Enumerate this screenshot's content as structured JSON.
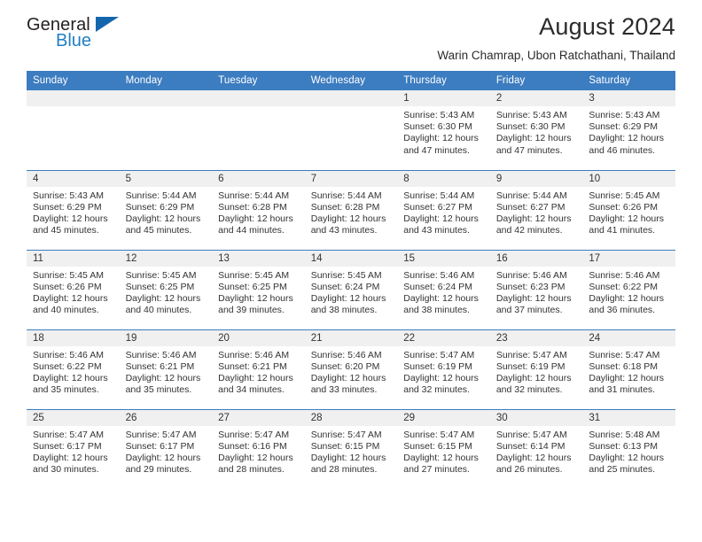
{
  "brand": {
    "line1": "General",
    "line2": "Blue",
    "triangle_color": "#1466ad",
    "blue_color": "#1f7ec4"
  },
  "header": {
    "title": "August 2024",
    "subtitle": "Warin Chamrap, Ubon Ratchathani, Thailand"
  },
  "theme": {
    "header_blue": "#3c7cc0",
    "daynum_gray": "#f0f0f0",
    "text": "#333333"
  },
  "weekdays": [
    "Sunday",
    "Monday",
    "Tuesday",
    "Wednesday",
    "Thursday",
    "Friday",
    "Saturday"
  ],
  "weeks": [
    [
      {
        "day": "",
        "sunrise": "",
        "sunset": "",
        "daylight1": "",
        "daylight2": ""
      },
      {
        "day": "",
        "sunrise": "",
        "sunset": "",
        "daylight1": "",
        "daylight2": ""
      },
      {
        "day": "",
        "sunrise": "",
        "sunset": "",
        "daylight1": "",
        "daylight2": ""
      },
      {
        "day": "",
        "sunrise": "",
        "sunset": "",
        "daylight1": "",
        "daylight2": ""
      },
      {
        "day": "1",
        "sunrise": "Sunrise: 5:43 AM",
        "sunset": "Sunset: 6:30 PM",
        "daylight1": "Daylight: 12 hours",
        "daylight2": "and 47 minutes."
      },
      {
        "day": "2",
        "sunrise": "Sunrise: 5:43 AM",
        "sunset": "Sunset: 6:30 PM",
        "daylight1": "Daylight: 12 hours",
        "daylight2": "and 47 minutes."
      },
      {
        "day": "3",
        "sunrise": "Sunrise: 5:43 AM",
        "sunset": "Sunset: 6:29 PM",
        "daylight1": "Daylight: 12 hours",
        "daylight2": "and 46 minutes."
      }
    ],
    [
      {
        "day": "4",
        "sunrise": "Sunrise: 5:43 AM",
        "sunset": "Sunset: 6:29 PM",
        "daylight1": "Daylight: 12 hours",
        "daylight2": "and 45 minutes."
      },
      {
        "day": "5",
        "sunrise": "Sunrise: 5:44 AM",
        "sunset": "Sunset: 6:29 PM",
        "daylight1": "Daylight: 12 hours",
        "daylight2": "and 45 minutes."
      },
      {
        "day": "6",
        "sunrise": "Sunrise: 5:44 AM",
        "sunset": "Sunset: 6:28 PM",
        "daylight1": "Daylight: 12 hours",
        "daylight2": "and 44 minutes."
      },
      {
        "day": "7",
        "sunrise": "Sunrise: 5:44 AM",
        "sunset": "Sunset: 6:28 PM",
        "daylight1": "Daylight: 12 hours",
        "daylight2": "and 43 minutes."
      },
      {
        "day": "8",
        "sunrise": "Sunrise: 5:44 AM",
        "sunset": "Sunset: 6:27 PM",
        "daylight1": "Daylight: 12 hours",
        "daylight2": "and 43 minutes."
      },
      {
        "day": "9",
        "sunrise": "Sunrise: 5:44 AM",
        "sunset": "Sunset: 6:27 PM",
        "daylight1": "Daylight: 12 hours",
        "daylight2": "and 42 minutes."
      },
      {
        "day": "10",
        "sunrise": "Sunrise: 5:45 AM",
        "sunset": "Sunset: 6:26 PM",
        "daylight1": "Daylight: 12 hours",
        "daylight2": "and 41 minutes."
      }
    ],
    [
      {
        "day": "11",
        "sunrise": "Sunrise: 5:45 AM",
        "sunset": "Sunset: 6:26 PM",
        "daylight1": "Daylight: 12 hours",
        "daylight2": "and 40 minutes."
      },
      {
        "day": "12",
        "sunrise": "Sunrise: 5:45 AM",
        "sunset": "Sunset: 6:25 PM",
        "daylight1": "Daylight: 12 hours",
        "daylight2": "and 40 minutes."
      },
      {
        "day": "13",
        "sunrise": "Sunrise: 5:45 AM",
        "sunset": "Sunset: 6:25 PM",
        "daylight1": "Daylight: 12 hours",
        "daylight2": "and 39 minutes."
      },
      {
        "day": "14",
        "sunrise": "Sunrise: 5:45 AM",
        "sunset": "Sunset: 6:24 PM",
        "daylight1": "Daylight: 12 hours",
        "daylight2": "and 38 minutes."
      },
      {
        "day": "15",
        "sunrise": "Sunrise: 5:46 AM",
        "sunset": "Sunset: 6:24 PM",
        "daylight1": "Daylight: 12 hours",
        "daylight2": "and 38 minutes."
      },
      {
        "day": "16",
        "sunrise": "Sunrise: 5:46 AM",
        "sunset": "Sunset: 6:23 PM",
        "daylight1": "Daylight: 12 hours",
        "daylight2": "and 37 minutes."
      },
      {
        "day": "17",
        "sunrise": "Sunrise: 5:46 AM",
        "sunset": "Sunset: 6:22 PM",
        "daylight1": "Daylight: 12 hours",
        "daylight2": "and 36 minutes."
      }
    ],
    [
      {
        "day": "18",
        "sunrise": "Sunrise: 5:46 AM",
        "sunset": "Sunset: 6:22 PM",
        "daylight1": "Daylight: 12 hours",
        "daylight2": "and 35 minutes."
      },
      {
        "day": "19",
        "sunrise": "Sunrise: 5:46 AM",
        "sunset": "Sunset: 6:21 PM",
        "daylight1": "Daylight: 12 hours",
        "daylight2": "and 35 minutes."
      },
      {
        "day": "20",
        "sunrise": "Sunrise: 5:46 AM",
        "sunset": "Sunset: 6:21 PM",
        "daylight1": "Daylight: 12 hours",
        "daylight2": "and 34 minutes."
      },
      {
        "day": "21",
        "sunrise": "Sunrise: 5:46 AM",
        "sunset": "Sunset: 6:20 PM",
        "daylight1": "Daylight: 12 hours",
        "daylight2": "and 33 minutes."
      },
      {
        "day": "22",
        "sunrise": "Sunrise: 5:47 AM",
        "sunset": "Sunset: 6:19 PM",
        "daylight1": "Daylight: 12 hours",
        "daylight2": "and 32 minutes."
      },
      {
        "day": "23",
        "sunrise": "Sunrise: 5:47 AM",
        "sunset": "Sunset: 6:19 PM",
        "daylight1": "Daylight: 12 hours",
        "daylight2": "and 32 minutes."
      },
      {
        "day": "24",
        "sunrise": "Sunrise: 5:47 AM",
        "sunset": "Sunset: 6:18 PM",
        "daylight1": "Daylight: 12 hours",
        "daylight2": "and 31 minutes."
      }
    ],
    [
      {
        "day": "25",
        "sunrise": "Sunrise: 5:47 AM",
        "sunset": "Sunset: 6:17 PM",
        "daylight1": "Daylight: 12 hours",
        "daylight2": "and 30 minutes."
      },
      {
        "day": "26",
        "sunrise": "Sunrise: 5:47 AM",
        "sunset": "Sunset: 6:17 PM",
        "daylight1": "Daylight: 12 hours",
        "daylight2": "and 29 minutes."
      },
      {
        "day": "27",
        "sunrise": "Sunrise: 5:47 AM",
        "sunset": "Sunset: 6:16 PM",
        "daylight1": "Daylight: 12 hours",
        "daylight2": "and 28 minutes."
      },
      {
        "day": "28",
        "sunrise": "Sunrise: 5:47 AM",
        "sunset": "Sunset: 6:15 PM",
        "daylight1": "Daylight: 12 hours",
        "daylight2": "and 28 minutes."
      },
      {
        "day": "29",
        "sunrise": "Sunrise: 5:47 AM",
        "sunset": "Sunset: 6:15 PM",
        "daylight1": "Daylight: 12 hours",
        "daylight2": "and 27 minutes."
      },
      {
        "day": "30",
        "sunrise": "Sunrise: 5:47 AM",
        "sunset": "Sunset: 6:14 PM",
        "daylight1": "Daylight: 12 hours",
        "daylight2": "and 26 minutes."
      },
      {
        "day": "31",
        "sunrise": "Sunrise: 5:48 AM",
        "sunset": "Sunset: 6:13 PM",
        "daylight1": "Daylight: 12 hours",
        "daylight2": "and 25 minutes."
      }
    ]
  ]
}
